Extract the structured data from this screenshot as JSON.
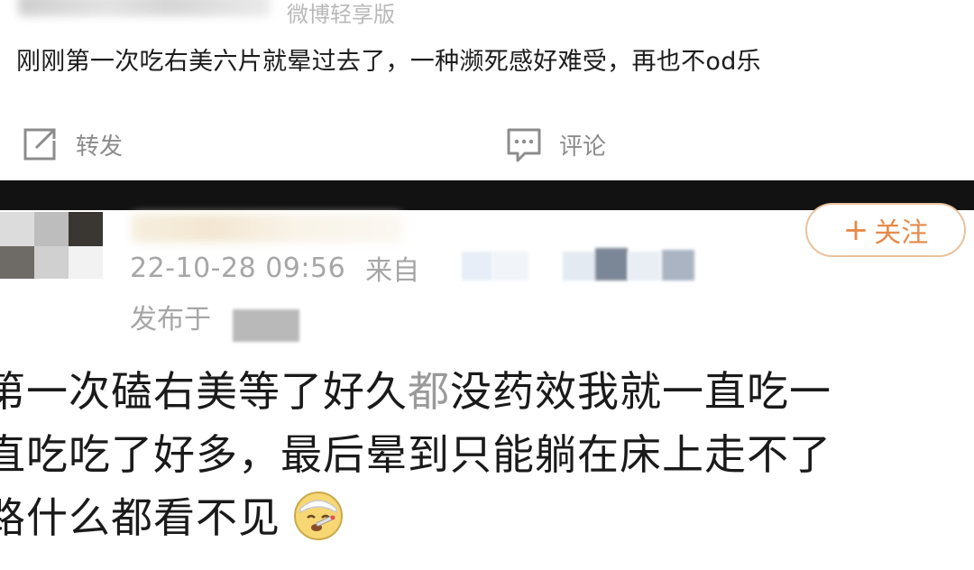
{
  "post": {
    "source_app": "微博轻享版",
    "text": "刚刚第一次吃右美六片就晕过去了，一种濒死感好难受，再也不od乐",
    "actions": {
      "repost_label": "转发",
      "comment_label": "评论"
    }
  },
  "reply": {
    "follow_label": "关注",
    "follow_plus": "+",
    "date": "22-10-28 09:56",
    "from_label": "来自",
    "published_label": "发布于",
    "body": {
      "line1_a": "第一次磕右美等了好久",
      "line1_hl": "都",
      "line1_b": "没药效我就一直吃一",
      "line2": "直吃吃了好多，最后晕到只能躺在床上走不了",
      "line3": "路什么都看不见"
    },
    "emoji": "sick-thermometer-face-emoji"
  },
  "colors": {
    "accent_orange": "#e58a4a",
    "follow_border": "#e9c29d",
    "muted_gray": "#a6a6a6",
    "divider": "#121212"
  }
}
